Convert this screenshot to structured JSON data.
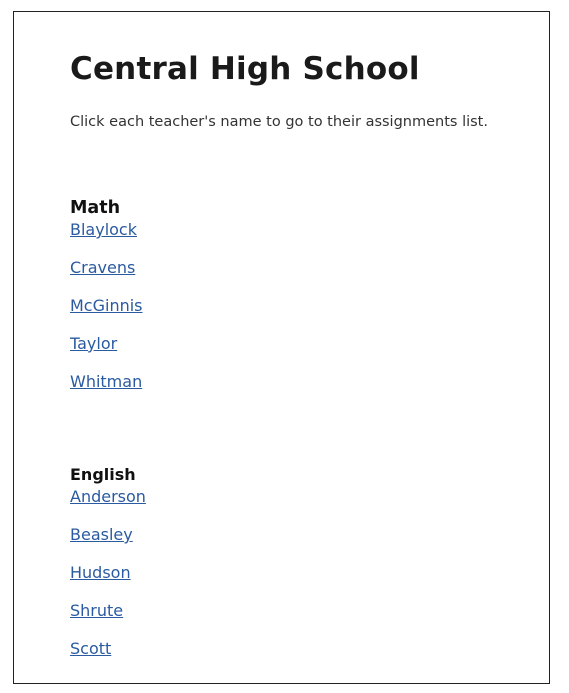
{
  "page": {
    "title": "Central High School",
    "subtitle": "Click each teacher's name to go to their assignments list."
  },
  "departments": [
    {
      "name": "Math",
      "teachers": [
        "Blaylock",
        "Cravens",
        "McGinnis",
        "Taylor",
        "Whitman"
      ]
    },
    {
      "name": "English",
      "teachers": [
        "Anderson",
        "Beasley",
        "Hudson",
        "Shrute",
        "Scott"
      ]
    }
  ],
  "colors": {
    "link": "#2a5aa0",
    "text": "#1a1a1a",
    "border": "#222222"
  }
}
